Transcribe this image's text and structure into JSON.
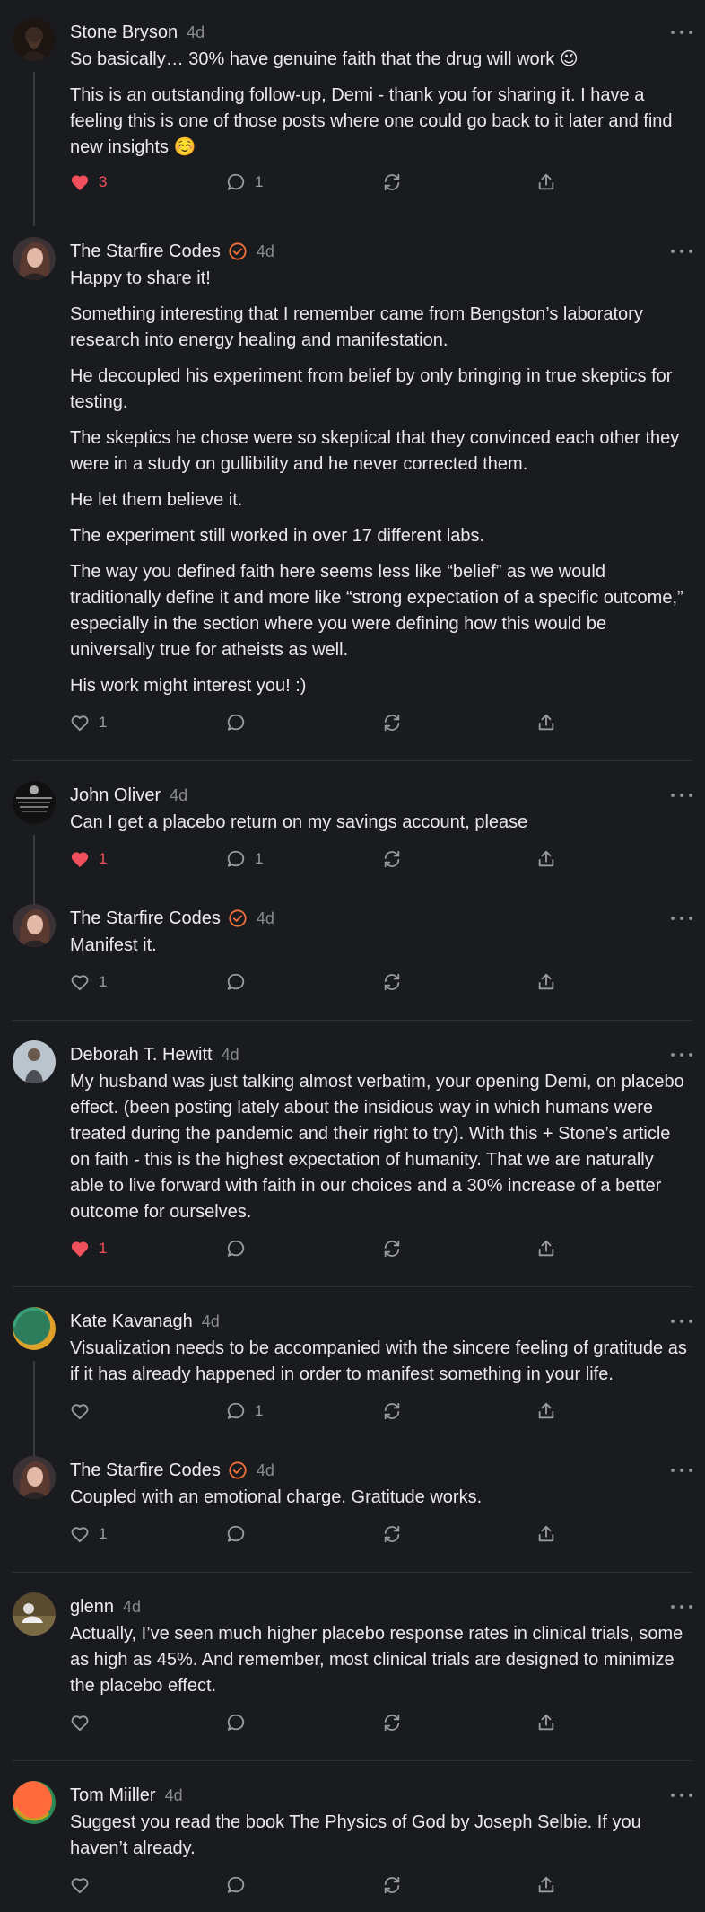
{
  "colors": {
    "background": "#1a1b1e",
    "text": "#e9e9ec",
    "muted": "#8a8b90",
    "like_active": "#f0505c",
    "verified": "#f0703c"
  },
  "comments": [
    {
      "author": "Stone Bryson",
      "time": "4d",
      "verified": false,
      "avatar_icon": "avatar-photo",
      "paragraphs": [
        "So basically… 30% have genuine faith that the drug will work 😉",
        "This is an outstanding follow-up, Demi - thank you for sharing it. I have a feeling this is one of those posts where one could go back to it later and find new insights ☺️"
      ],
      "likes": "3",
      "liked": true,
      "replies": "1"
    },
    {
      "author": "The Starfire Codes",
      "time": "4d",
      "verified": true,
      "avatar_icon": "avatar-photo",
      "paragraphs": [
        "Happy to share it!",
        "Something interesting that I remember came from Bengston’s laboratory research into energy healing and manifestation.",
        "He decoupled his experiment from belief by only bringing in true skeptics for testing.",
        "The skeptics he chose were so skeptical that they convinced each other they were in a study on gullibility and he never corrected them.",
        "He let them believe it.",
        "The experiment still worked in over 17 different labs.",
        "The way you defined faith here seems less like “belief” as we would traditionally define it and more like “strong expectation of a specific outcome,” especially in the section where you were defining how this would be universally true for atheists as well.",
        "His work might interest you! :)"
      ],
      "likes": "1",
      "liked": false,
      "replies": ""
    },
    {
      "author": "John Oliver",
      "time": "4d",
      "verified": false,
      "avatar_icon": "avatar-photo",
      "paragraphs": [
        "Can I get a placebo return on my savings account, please"
      ],
      "likes": "1",
      "liked": true,
      "replies": "1"
    },
    {
      "author": "The Starfire Codes",
      "time": "4d",
      "verified": true,
      "avatar_icon": "avatar-photo",
      "paragraphs": [
        "Manifest it."
      ],
      "likes": "1",
      "liked": false,
      "replies": ""
    },
    {
      "author": "Deborah T. Hewitt",
      "time": "4d",
      "verified": false,
      "avatar_icon": "avatar-photo",
      "paragraphs": [
        "My husband was just talking almost verbatim, your opening Demi, on placebo effect. (been posting lately about the insidious way in which humans were treated during the pandemic and their right to try). With this + Stone’s article on faith - this is the highest expectation of humanity. That we are naturally able to live forward with faith in our choices and a 30% increase of a better outcome for ourselves."
      ],
      "likes": "1",
      "liked": true,
      "replies": ""
    },
    {
      "author": "Kate Kavanagh",
      "time": "4d",
      "verified": false,
      "avatar_icon": "avatar-generated",
      "paragraphs": [
        "Visualization needs to be accompanied with the sincere feeling of gratitude as if it has already happened in order to manifest something in your life."
      ],
      "likes": "",
      "liked": false,
      "replies": "1"
    },
    {
      "author": "The Starfire Codes",
      "time": "4d",
      "verified": true,
      "avatar_icon": "avatar-photo",
      "paragraphs": [
        "Coupled with an emotional charge. Gratitude works."
      ],
      "likes": "1",
      "liked": false,
      "replies": ""
    },
    {
      "author": "glenn",
      "time": "4d",
      "verified": false,
      "avatar_icon": "avatar-photo",
      "paragraphs": [
        "Actually, I’ve seen much higher placebo response rates in clinical trials, some as high as 45%. And remember, most clinical trials are designed to minimize the placebo effect."
      ],
      "likes": "",
      "liked": false,
      "replies": ""
    },
    {
      "author": "Tom Miiller",
      "time": "4d",
      "verified": false,
      "avatar_icon": "avatar-generated",
      "paragraphs": [
        "Suggest you read the book The Physics of God by Joseph Selbie. If you haven’t already."
      ],
      "likes": "",
      "liked": false,
      "replies": ""
    }
  ]
}
